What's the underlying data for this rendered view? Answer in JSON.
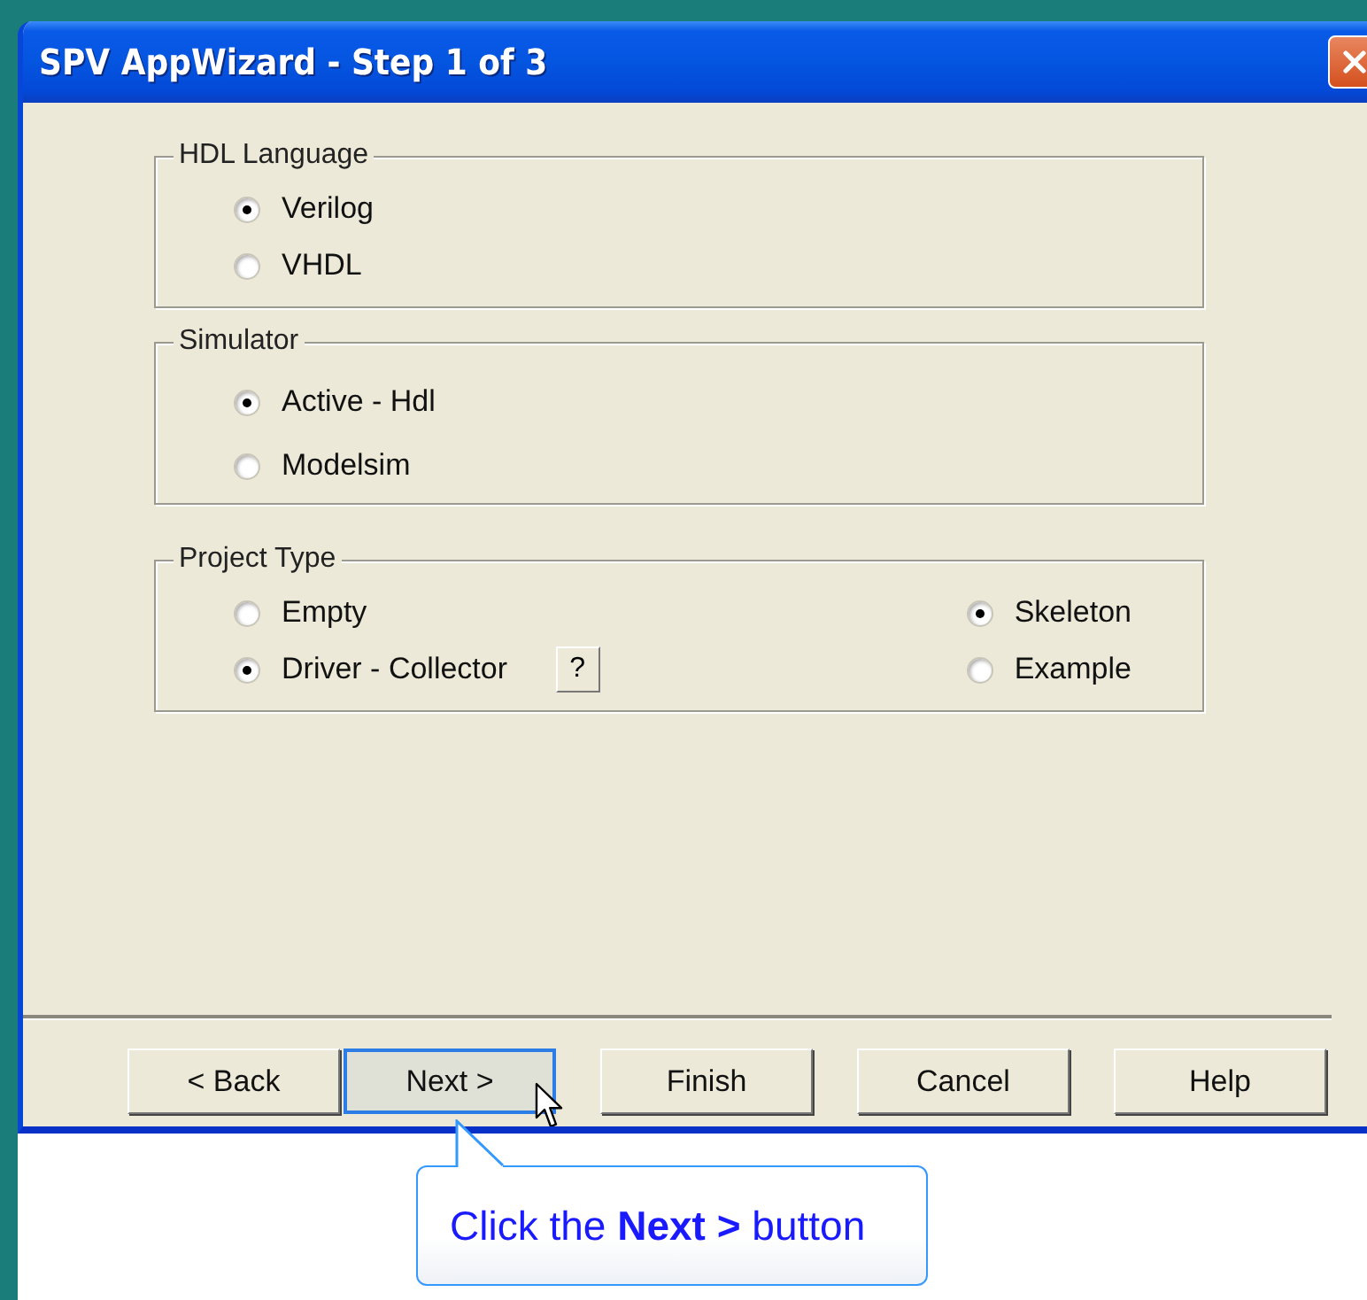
{
  "window": {
    "title": "SPV AppWizard - Step 1 of 3"
  },
  "groups": [
    {
      "title": "HDL Language",
      "columns": [
        [
          {
            "label": "Verilog",
            "selected": true
          },
          {
            "label": "VHDL",
            "selected": false
          }
        ]
      ]
    },
    {
      "title": "Simulator",
      "columns": [
        [
          {
            "label": "Active - Hdl",
            "selected": true
          },
          {
            "label": "Modelsim",
            "selected": false
          }
        ]
      ]
    },
    {
      "title": "Project Type",
      "columns": [
        [
          {
            "label": "Empty",
            "selected": false
          },
          {
            "label": "Driver - Collector",
            "selected": true,
            "help_button": "?"
          }
        ],
        [
          {
            "label": "Skeleton",
            "selected": true
          },
          {
            "label": "Example",
            "selected": false
          }
        ]
      ]
    }
  ],
  "buttons": [
    {
      "label": "< Back",
      "focused": false
    },
    {
      "label": "Next >",
      "focused": true
    },
    {
      "label": "Finish",
      "focused": false
    },
    {
      "label": "Cancel",
      "focused": false
    },
    {
      "label": "Help",
      "focused": false
    }
  ],
  "callout": {
    "text": "Click the **Next >** button"
  }
}
